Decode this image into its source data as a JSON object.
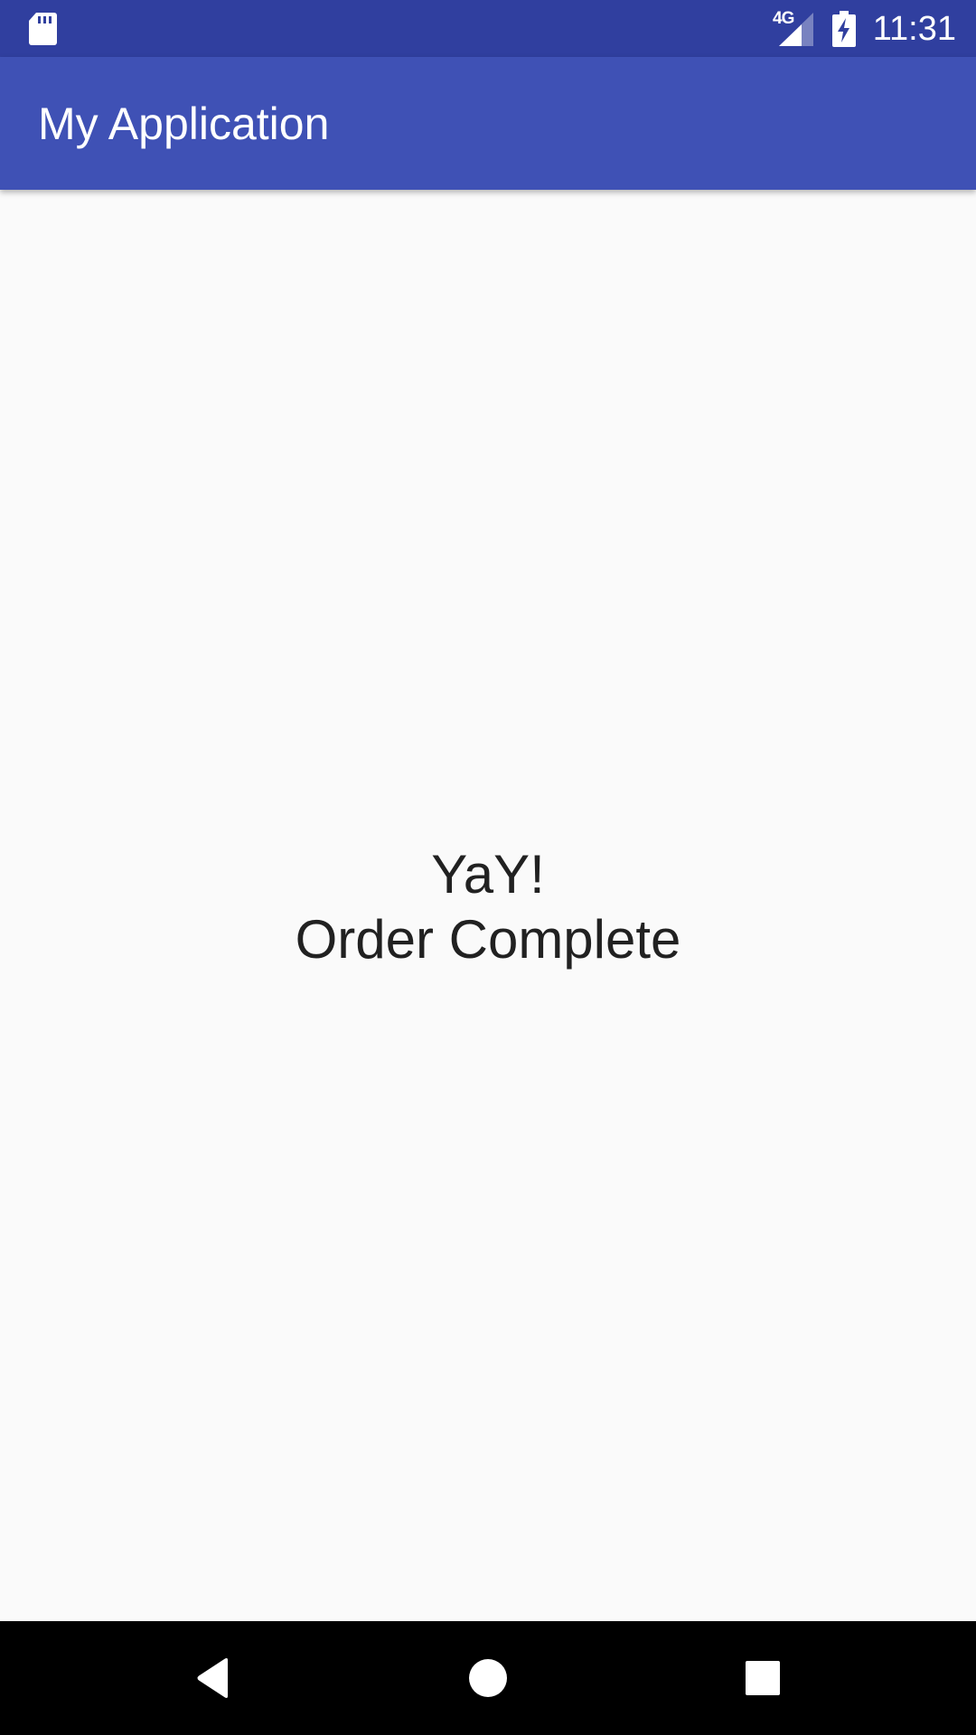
{
  "status_bar": {
    "network": "4G",
    "time": "11:31",
    "background": "#303f9f",
    "icons": [
      "sd-card-icon",
      "signal-icon",
      "battery-charging-icon"
    ]
  },
  "app_bar": {
    "title": "My Application",
    "background": "#3f51b5"
  },
  "content": {
    "line1": "YaY!",
    "line2": "Order Complete",
    "text_color": "#212121",
    "background": "#fafafa"
  },
  "nav_bar": {
    "background": "#000000",
    "buttons": [
      "back-icon",
      "home-icon",
      "recents-icon"
    ]
  }
}
